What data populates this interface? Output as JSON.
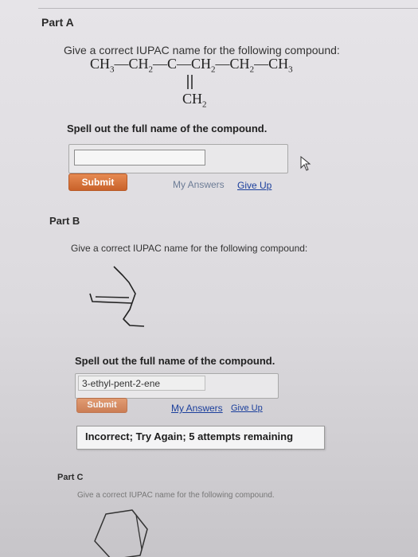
{
  "part_a": {
    "title": "Part A",
    "question": "Give a correct IUPAC name for the following compound:",
    "instruction": "Spell out the full name of the compound.",
    "answer_value": "",
    "submit_label": "Submit",
    "my_answers_label": "My Answers",
    "give_up_label": "Give Up"
  },
  "part_b": {
    "title": "Part B",
    "question": "Give a correct IUPAC name for the following compound:",
    "instruction": "Spell out the full name of the compound.",
    "answer_value": "3-ethyl-pent-2-ene",
    "submit_label": "Submit",
    "my_answers_label": "My Answers",
    "give_up_label": "Give Up",
    "feedback": "Incorrect; Try Again; 5 attempts remaining"
  },
  "part_c": {
    "title": "Part C",
    "question": "Give a correct IUPAC name for the following compound."
  },
  "colors": {
    "submit": "#d4733a",
    "link_blue": "#1b3f9c",
    "link_gray": "#6c7c96"
  },
  "icons": {
    "cursor": "mouse-pointer-icon"
  }
}
